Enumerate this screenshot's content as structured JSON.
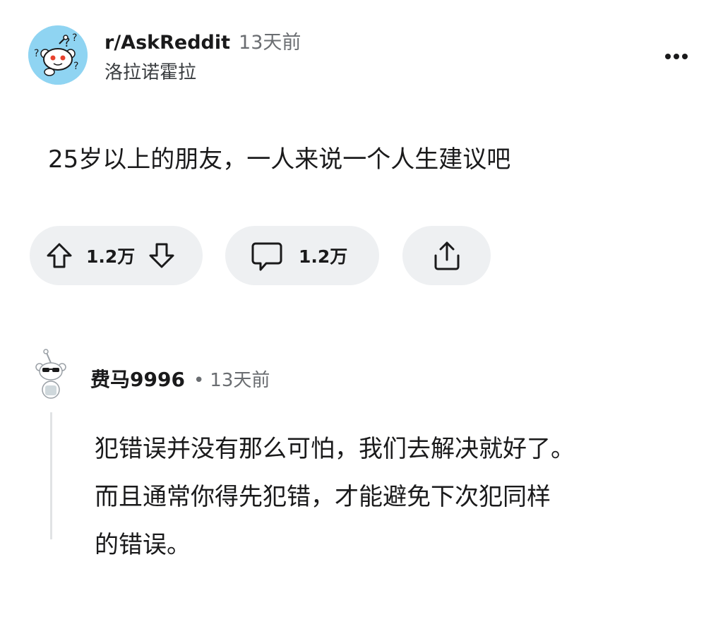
{
  "post": {
    "subreddit": "r/AskReddit",
    "time_ago": "13天前",
    "author": "洛拉诺霍拉",
    "title": "25岁以上的朋友，一人来说一个人生建议吧",
    "more_icon": "more-horizontal-icon"
  },
  "actions": {
    "vote_count": "1.2万",
    "comment_count": "1.2万",
    "icons": [
      "upvote-icon",
      "downvote-icon",
      "comment-icon",
      "share-icon"
    ]
  },
  "comment": {
    "author": "费马9996",
    "separator": "•",
    "time_ago": "13天前",
    "body_lines": [
      "犯错误并没有那么可怕，我们去解决就好了。",
      "而且通常你得先犯错，才能避免下次犯同样",
      "的错误。"
    ]
  },
  "colors": {
    "pill_bg": "#eef0f2",
    "subreddit_avatar_bg": "#8fd4f2",
    "meta_text": "#6a6d71"
  }
}
